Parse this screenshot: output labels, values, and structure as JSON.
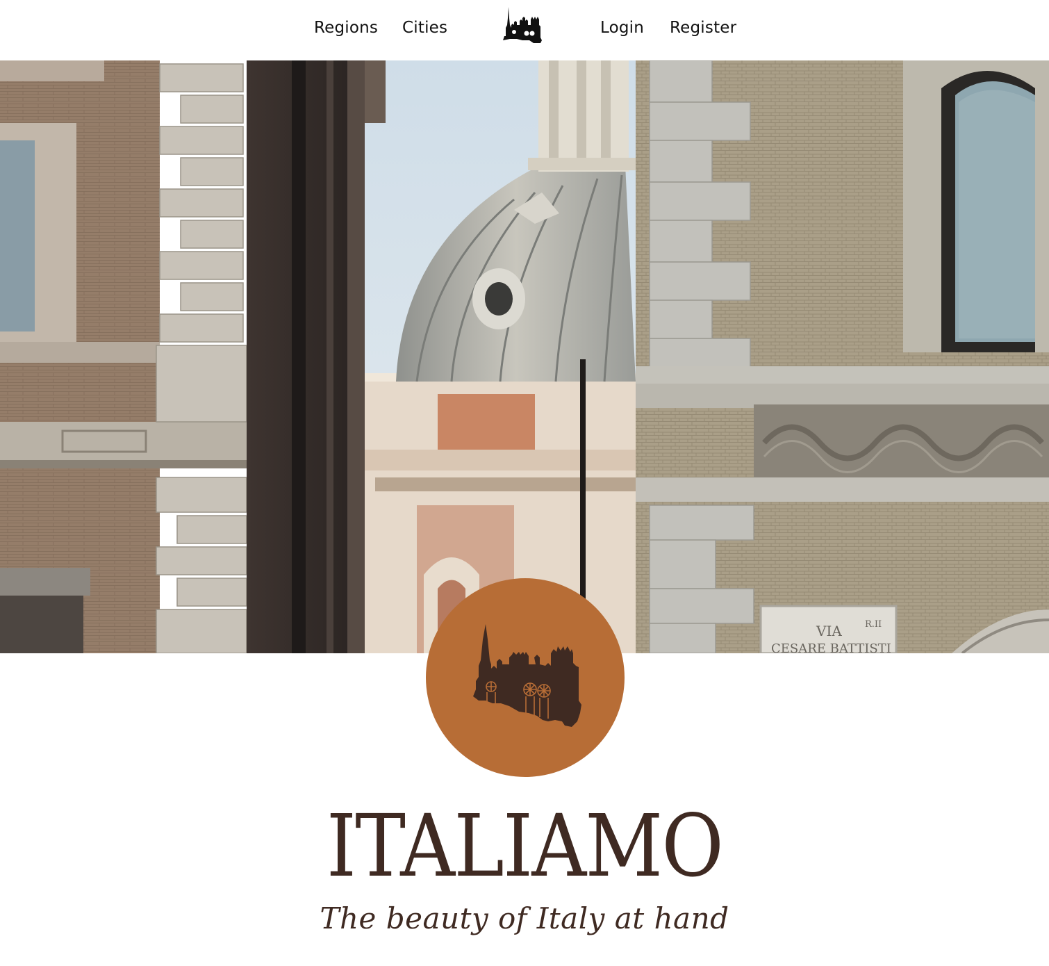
{
  "nav": {
    "links_left": [
      {
        "label": "Regions"
      },
      {
        "label": "Cities"
      }
    ],
    "links_right": [
      {
        "label": "Login"
      },
      {
        "label": "Register"
      }
    ],
    "logo_icon": "cathedral-silhouette-icon"
  },
  "hero": {
    "image": "rome-street-church-dome-photo"
  },
  "emblem": {
    "icon": "cathedral-silhouette-icon",
    "background_color": "#b76d36",
    "icon_color": "#3f2a22"
  },
  "brand": {
    "title": "ITALIAMO",
    "tagline": "The beauty of Italy at hand",
    "text_color": "#3f2a22"
  }
}
